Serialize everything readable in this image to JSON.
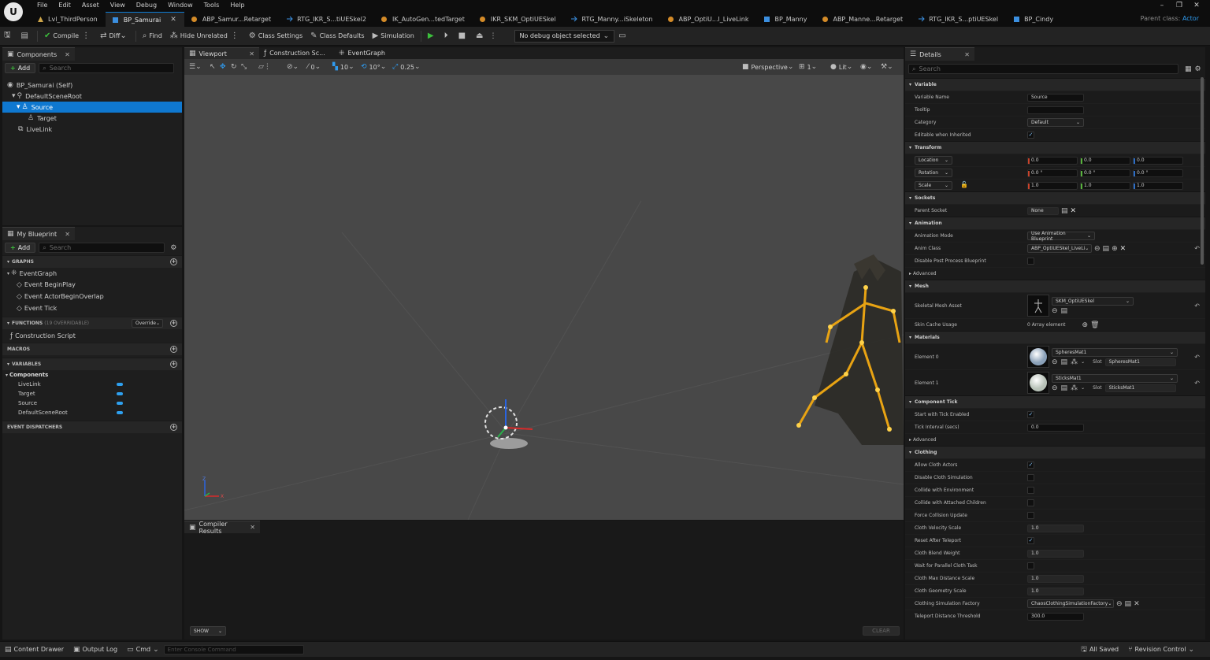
{
  "app": {
    "logo": "U",
    "parent_class_label": "Parent class:",
    "parent_class_value": "Actor"
  },
  "menu": [
    "File",
    "Edit",
    "Asset",
    "View",
    "Debug",
    "Window",
    "Tools",
    "Help"
  ],
  "window_controls": [
    "–",
    "❐",
    "✕"
  ],
  "tabs": [
    {
      "label": "Lvl_ThirdPerson",
      "icon": "level-icon"
    },
    {
      "label": "BP_Samurai",
      "icon": "blueprint-icon",
      "active": true
    },
    {
      "label": "ABP_Samur...Retarget",
      "icon": "anim-blueprint-icon"
    },
    {
      "label": "RTG_IKR_S...tiUESkel2",
      "icon": "retarget-icon"
    },
    {
      "label": "IK_AutoGen...tedTarget",
      "icon": "ik-rig-icon"
    },
    {
      "label": "IKR_SKM_OptiUESkel",
      "icon": "ik-rig-icon"
    },
    {
      "label": "RTG_Manny...iSkeleton",
      "icon": "retarget-icon"
    },
    {
      "label": "ABP_OptiU...l_LiveLink",
      "icon": "anim-blueprint-icon"
    },
    {
      "label": "BP_Manny",
      "icon": "blueprint-icon"
    },
    {
      "label": "ABP_Manne...Retarget",
      "icon": "anim-blueprint-icon"
    },
    {
      "label": "RTG_IKR_S...ptiUESkel",
      "icon": "retarget-icon"
    },
    {
      "label": "BP_Cindy",
      "icon": "blueprint-icon"
    }
  ],
  "toolbar": {
    "compile": "Compile",
    "diff": "Diff",
    "find": "Find",
    "hide_unrelated": "Hide Unrelated",
    "class_settings": "Class Settings",
    "class_defaults": "Class Defaults",
    "simulation": "Simulation",
    "debug_object": "No debug object selected"
  },
  "components": {
    "tab": "Components",
    "add": "Add",
    "search_placeholder": "Search",
    "items": [
      {
        "label": "BP_Samurai (Self)"
      },
      {
        "label": "DefaultSceneRoot"
      },
      {
        "label": "Source",
        "selected": true
      },
      {
        "label": "Target"
      },
      {
        "label": "LiveLink"
      }
    ]
  },
  "my_blueprint": {
    "tab": "My Blueprint",
    "add": "Add",
    "search_placeholder": "Search",
    "graphs_header": "GRAPHS",
    "event_graph": "EventGraph",
    "events": [
      "Event BeginPlay",
      "Event ActorBeginOverlap",
      "Event Tick"
    ],
    "functions_header": "FUNCTIONS",
    "functions_count": "(19 OVERRIDABLE)",
    "override": "Override",
    "construction_script": "Construction Script",
    "macros_header": "MACROS",
    "variables_header": "VARIABLES",
    "components_group": "Components",
    "variables": [
      "LiveLink",
      "Target",
      "Source",
      "DefaultSceneRoot"
    ],
    "dispatchers_header": "EVENT DISPATCHERS"
  },
  "viewport": {
    "tabs": [
      "Viewport",
      "Construction Sc...",
      "EventGraph"
    ],
    "snap_translate": "0",
    "snap_grid": "10",
    "snap_rotate": "10°",
    "snap_scale": "0.25",
    "perspective": "Perspective",
    "layout": "1",
    "lit": "Lit",
    "axis_z": "Z",
    "axis_x": "X"
  },
  "compiler": {
    "tab": "Compiler Results",
    "show": "SHOW",
    "clear": "CLEAR"
  },
  "details": {
    "tab": "Details",
    "search_placeholder": "Search",
    "sections": {
      "variable": "Variable",
      "transform": "Transform",
      "sockets": "Sockets",
      "animation": "Animation",
      "advanced": "Advanced",
      "mesh": "Mesh",
      "materials": "Materials",
      "component_tick": "Component Tick",
      "advanced2": "Advanced",
      "clothing": "Clothing"
    },
    "variable_name_label": "Variable Name",
    "variable_name": "Source",
    "tooltip_label": "Tooltip",
    "tooltip": "",
    "category_label": "Category",
    "category": "Default",
    "editable_label": "Editable when Inherited",
    "location": "Location",
    "rotation": "Rotation",
    "scale": "Scale",
    "loc_values": [
      "0.0",
      "0.0",
      "0.0"
    ],
    "rot_values": [
      "0.0 °",
      "0.0 °",
      "0.0 °"
    ],
    "scale_values": [
      "1.0",
      "1.0",
      "1.0"
    ],
    "parent_socket_label": "Parent Socket",
    "parent_socket": "None",
    "anim_mode_label": "Animation Mode",
    "anim_mode": "Use Animation Blueprint",
    "anim_class_label": "Anim Class",
    "anim_class": "ABP_OptiUESkel_LiveLi",
    "disable_post_label": "Disable Post Process Blueprint",
    "skel_mesh_label": "Skeletal Mesh Asset",
    "skel_mesh": "SKM_OptiUESkel",
    "skin_cache_label": "Skin Cache Usage",
    "skin_cache": "0 Array element",
    "element0_label": "Element 0",
    "element0": "SpheresMat1",
    "slot_label": "Slot",
    "slot0": "SpheresMat1",
    "element1_label": "Element 1",
    "element1": "SticksMat1",
    "slot1": "SticksMat1",
    "tick_enabled_label": "Start with Tick Enabled",
    "tick_interval_label": "Tick Interval (secs)",
    "tick_interval": "0.0",
    "clothing_rows": [
      {
        "label": "Allow Cloth Actors",
        "type": "check",
        "checked": true
      },
      {
        "label": "Disable Cloth Simulation",
        "type": "check",
        "checked": false
      },
      {
        "label": "Collide with Environment",
        "type": "check",
        "checked": false
      },
      {
        "label": "Collide with Attached Children",
        "type": "check",
        "checked": false
      },
      {
        "label": "Force Collision Update",
        "type": "check",
        "checked": false
      },
      {
        "label": "Cloth Velocity Scale",
        "type": "num",
        "value": "1.0"
      },
      {
        "label": "Reset After Teleport",
        "type": "check",
        "checked": true
      },
      {
        "label": "Cloth Blend Weight",
        "type": "num",
        "value": "1.0"
      },
      {
        "label": "Wait for Parallel Cloth Task",
        "type": "check",
        "checked": false
      },
      {
        "label": "Cloth Max Distance Scale",
        "type": "num",
        "value": "1.0"
      },
      {
        "label": "Cloth Geometry Scale",
        "type": "num",
        "value": "1.0"
      },
      {
        "label": "Clothing Simulation Factory",
        "type": "combo",
        "value": "ChaosClothingSimulationFactory"
      },
      {
        "label": "Teleport Distance Threshold",
        "type": "num",
        "value": "300.0"
      }
    ]
  },
  "statusbar": {
    "content_drawer": "Content Drawer",
    "output_log": "Output Log",
    "cmd": "Cmd",
    "console_placeholder": "Enter Console Command",
    "all_saved": "All Saved",
    "revision_control": "Revision Control"
  }
}
